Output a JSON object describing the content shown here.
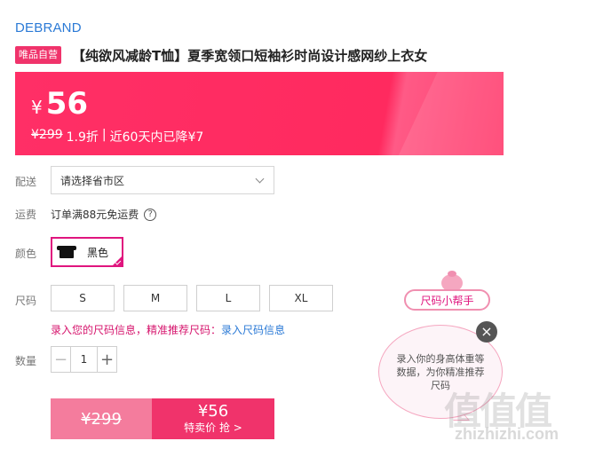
{
  "brand": "DEBRAND",
  "product": {
    "badge": "唯品自营",
    "title": "【纯欲风减龄T恤】夏季宽领口短袖衫时尚设计感网纱上衣女"
  },
  "price": {
    "currency": "¥",
    "current": "56",
    "original": "¥299",
    "discount": "1.9折",
    "separator": "|",
    "note": "近60天内已降¥7"
  },
  "delivery": {
    "label": "配送",
    "placeholder": "请选择省市区"
  },
  "shipping": {
    "label": "运费",
    "text": "订单满88元免运费",
    "help_icon": "?"
  },
  "color": {
    "label": "颜色",
    "selected": "黑色"
  },
  "size": {
    "label": "尺码",
    "options": [
      "S",
      "M",
      "L",
      "XL"
    ],
    "tip": "录入您的尺码信息，精准推荐尺码：",
    "tip_link": "录入尺码信息"
  },
  "quantity": {
    "label": "数量",
    "value": "1",
    "minus": "−",
    "plus": "+"
  },
  "buy": {
    "original": "¥299",
    "sale_price": "¥56",
    "sale_label": "特卖价 抢 >"
  },
  "helper": {
    "title": "尺码小帮手",
    "message": "录入你的身高体重等数据，为你精准推荐尺码",
    "close": "×"
  },
  "watermark": {
    "logo": "值值值",
    "text": "zhizhizhi.com"
  },
  "colors": {
    "accent": "#f0336b",
    "link": "#2b7ad6",
    "selected_border": "#e0157e"
  }
}
